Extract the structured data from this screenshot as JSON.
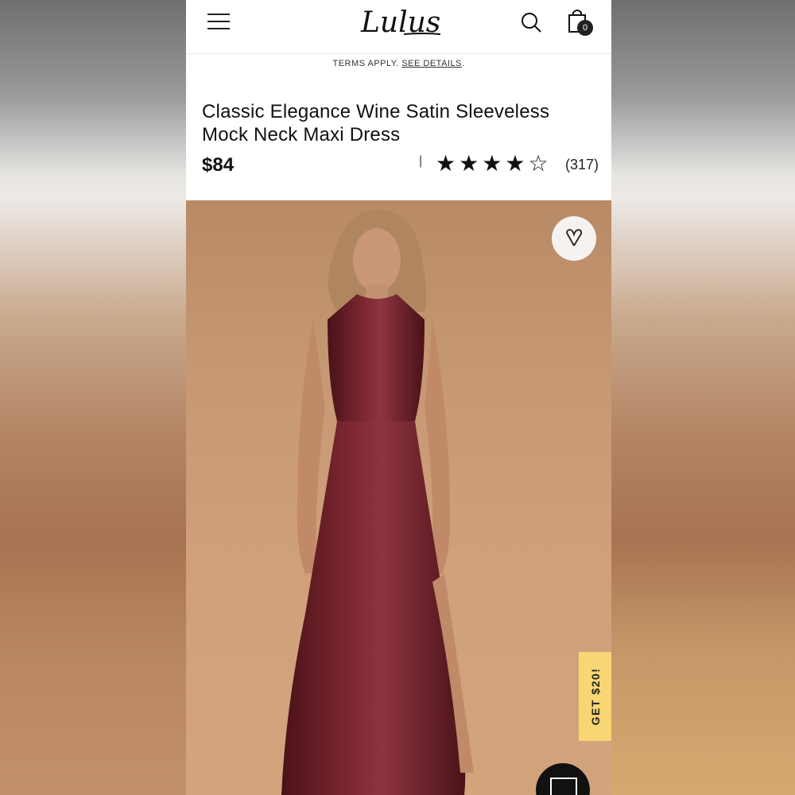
{
  "nav": {
    "logo": "Lulus",
    "cart_count": "0"
  },
  "promo": {
    "text": "TERMS APPLY.",
    "link": "SEE DETAILS",
    "suffix": "."
  },
  "product": {
    "title": "Classic Elegance Wine Satin Sleeveless Mock Neck Maxi Dress",
    "price": "$84",
    "divider": "|",
    "rating": 4,
    "rating_max": 5,
    "review_count": "(317)"
  },
  "promo_tab": {
    "label": "GET $20!"
  },
  "colors": {
    "dress": "#6a1e26",
    "photo_bg": "#c89a74",
    "promo_tab": "#f8d673"
  }
}
